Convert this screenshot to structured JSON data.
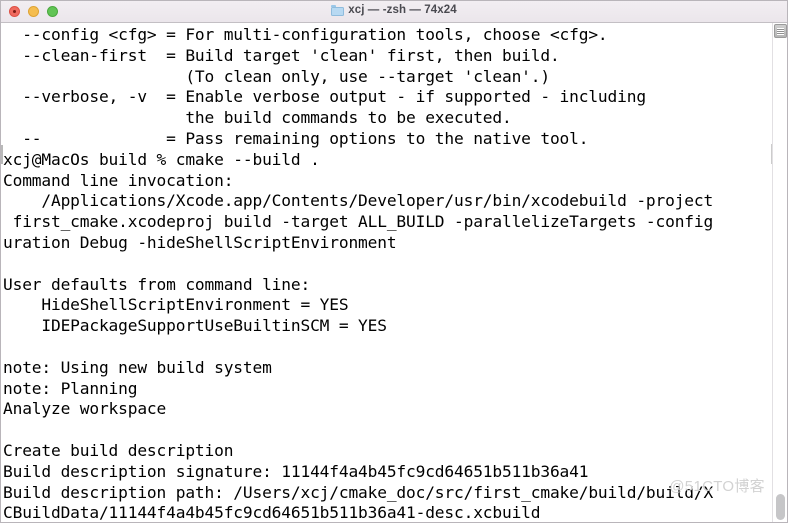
{
  "window": {
    "title": "xcj — -zsh — 74x24",
    "folder_icon": "folder-icon",
    "traffic_lights": [
      {
        "name": "close-button",
        "color": "#ef6a5f"
      },
      {
        "name": "minimize-button",
        "color": "#f5bd4f"
      },
      {
        "name": "maximize-button",
        "color": "#61c455"
      }
    ],
    "background": "#ffffff",
    "text_color": "#000000",
    "titlebar_color": "#efeaef",
    "columns": 74,
    "rows": 24
  },
  "terminal": {
    "prompt": "xcj@MacOs build % ",
    "command": "cmake --build .",
    "lines": [
      "  --config <cfg> = For multi-configuration tools, choose <cfg>.",
      "  --clean-first  = Build target 'clean' first, then build.",
      "                   (To clean only, use --target 'clean'.)",
      "  --verbose, -v  = Enable verbose output - if supported - including",
      "                   the build commands to be executed.",
      "  --             = Pass remaining options to the native tool.",
      "xcj@MacOs build % cmake --build .",
      "Command line invocation:",
      "    /Applications/Xcode.app/Contents/Developer/usr/bin/xcodebuild -project",
      " first_cmake.xcodeproj build -target ALL_BUILD -parallelizeTargets -config",
      "uration Debug -hideShellScriptEnvironment",
      "",
      "User defaults from command line:",
      "    HideShellScriptEnvironment = YES",
      "    IDEPackageSupportUseBuiltinSCM = YES",
      "",
      "note: Using new build system",
      "note: Planning",
      "Analyze workspace",
      "",
      "Create build description",
      "Build description signature: 11144f4a4b45fc9cd64651b511b36a41",
      "Build description path: /Users/xcj/cmake_doc/src/first_cmake/build/build/X",
      "CBuildData/11144f4a4b45fc9cd64651b511b36a41-desc.xcbuild"
    ]
  },
  "scrollbar": {
    "top_thumb": "scroll-elevator",
    "bottom_thumb": "scroll-thumb"
  },
  "watermark": {
    "text": "@51CTO博客",
    "color": "#d2d2d2"
  }
}
